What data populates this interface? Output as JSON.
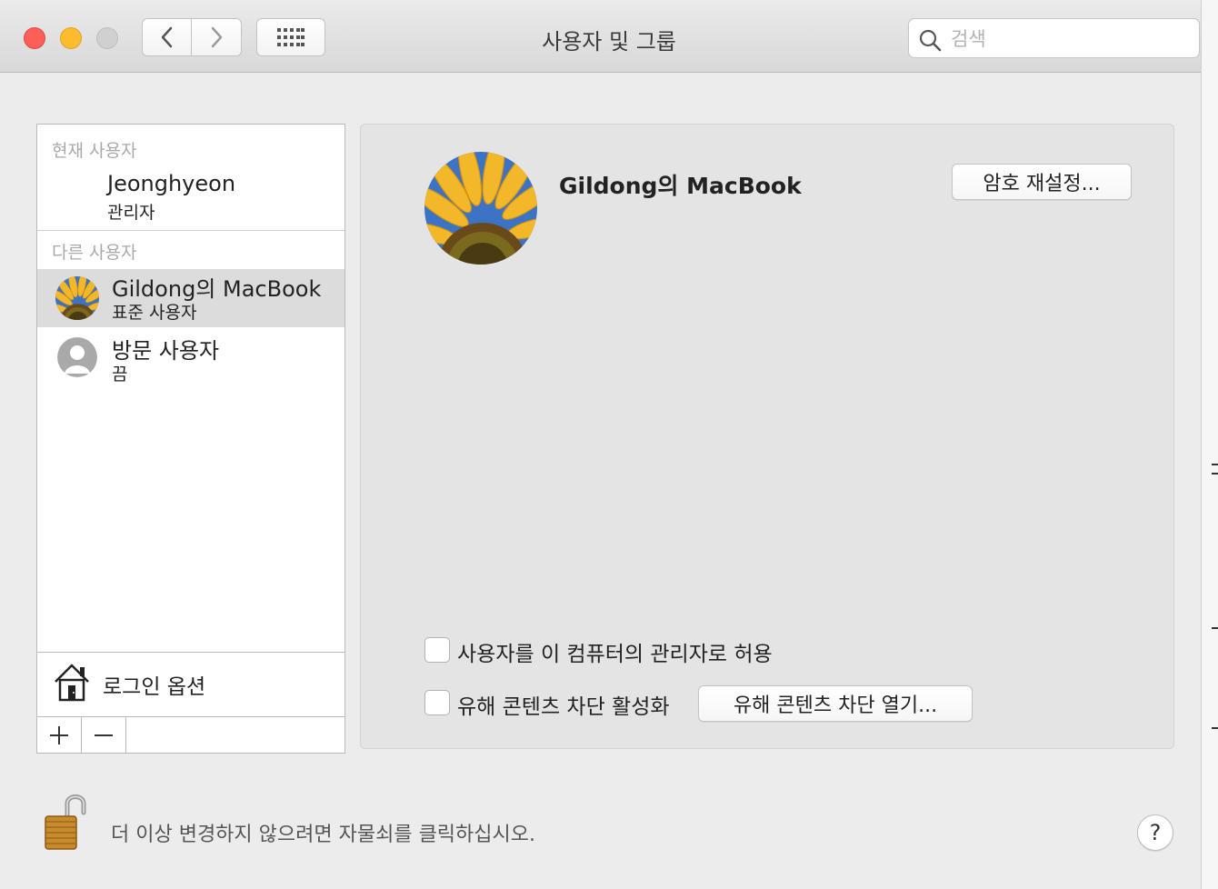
{
  "window": {
    "title": "사용자 및 그룹",
    "search_placeholder": "검색"
  },
  "sidebar": {
    "current_section_label": "현재 사용자",
    "current_user": {
      "name": "Jeonghyeon",
      "role": "관리자"
    },
    "other_section_label": "다른 사용자",
    "other_users": [
      {
        "name": "Gildong의 MacBook",
        "role": "표준 사용자",
        "avatar": "sunflower-image",
        "selected": true
      },
      {
        "name": "방문 사용자",
        "role": "끔",
        "avatar": "generic-user-icon",
        "selected": false
      }
    ],
    "login_options_label": "로그인 옵션",
    "add_label": "+",
    "remove_label": "−"
  },
  "main": {
    "user_name": "Gildong의 MacBook",
    "reset_password_label": "암호 재설정...",
    "allow_admin_label": "사용자를 이 컴퓨터의 관리자로 허용",
    "allow_admin_checked": false,
    "parental_controls_label": "유해 콘텐츠 차단 활성화",
    "parental_controls_checked": false,
    "open_parental_label": "유해 콘텐츠 차단 열기..."
  },
  "footer": {
    "lock_text": "더 이상 변경하지 않으려면 자물쇠를 클릭하십시오.",
    "help_label": "?"
  },
  "colors": {
    "close": "#fc5f57",
    "minimize": "#fdbc2e",
    "selection": "#dcdcdc",
    "panel": "#e4e4e4"
  }
}
